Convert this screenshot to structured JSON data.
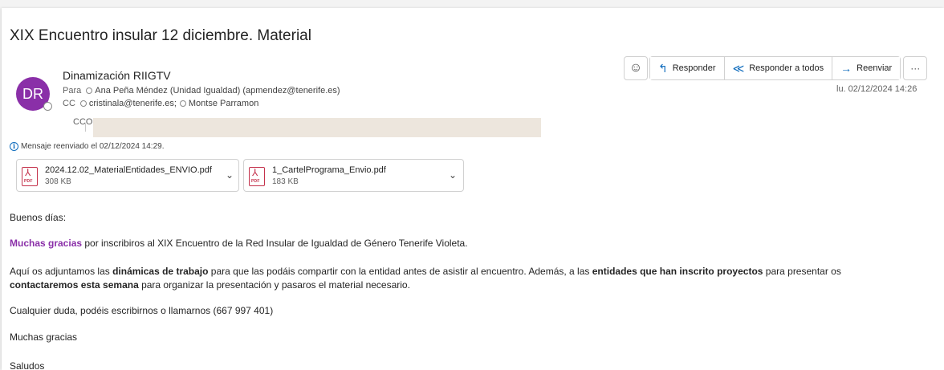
{
  "subject": "XIX Encuentro insular 12 diciembre. Material",
  "sender": {
    "initials": "DR",
    "name": "Dinamización RIIGTV",
    "avatar_color": "#8a2fa8"
  },
  "recipients": {
    "to_label": "Para",
    "to": "Ana Peña Méndez (Unidad Igualdad) (apmendez@tenerife.es)",
    "cc_label": "CC",
    "cc": [
      "cristinala@tenerife.es;",
      "Montse Parramon"
    ],
    "bcc_label": "CCO"
  },
  "forwarded_note": "Mensaje reenviado el 02/12/2024 14:29.",
  "attachments": [
    {
      "name": "2024.12.02_MaterialEntidades_ENVIO.pdf",
      "size": "308 KB",
      "icon": "pdf-icon",
      "icon_text": "PDF"
    },
    {
      "name": "1_CartelPrograma_Envio.pdf",
      "size": "183 KB",
      "icon": "pdf-icon",
      "icon_text": "PDF"
    }
  ],
  "toolbar": {
    "emoji_icon": "emoji-icon",
    "reply": "Responder",
    "reply_all": "Responder a todos",
    "forward": "Reenviar",
    "more_icon": "more-icon",
    "reply_glyph": "↰",
    "reply_all_glyph": "≪",
    "forward_glyph": "→",
    "more_glyph": "···",
    "emoji_glyph": "☺"
  },
  "date": "lu. 02/12/2024 14:26",
  "body": {
    "greeting": "Buenos días:",
    "p1_accent": "Muchas gracias",
    "p1_rest": " por inscribiros al XIX Encuentro de la Red Insular de Igualdad de Género Tenerife Violeta.",
    "p2_a": "Aquí os adjuntamos las ",
    "p2_b": "dinámicas de trabajo",
    "p2_c": " para que las podáis compartir con la entidad antes de asistir al encuentro. Además, a las ",
    "p2_d": "entidades que han inscrito proyectos",
    "p2_e": " para presentar os",
    "p2_f": "contactaremos esta semana",
    "p2_g": " para organizar la presentación y pasaros el material necesario.",
    "p3": "Cualquier duda, podéis escribirnos o llamarnos (667 997 401)",
    "p4": "Muchas gracias",
    "p5": "Saludos"
  },
  "colors": {
    "accent_purple": "#8a2fa8",
    "link_blue": "#0f6cbd",
    "pdf_red": "#c4314b"
  }
}
